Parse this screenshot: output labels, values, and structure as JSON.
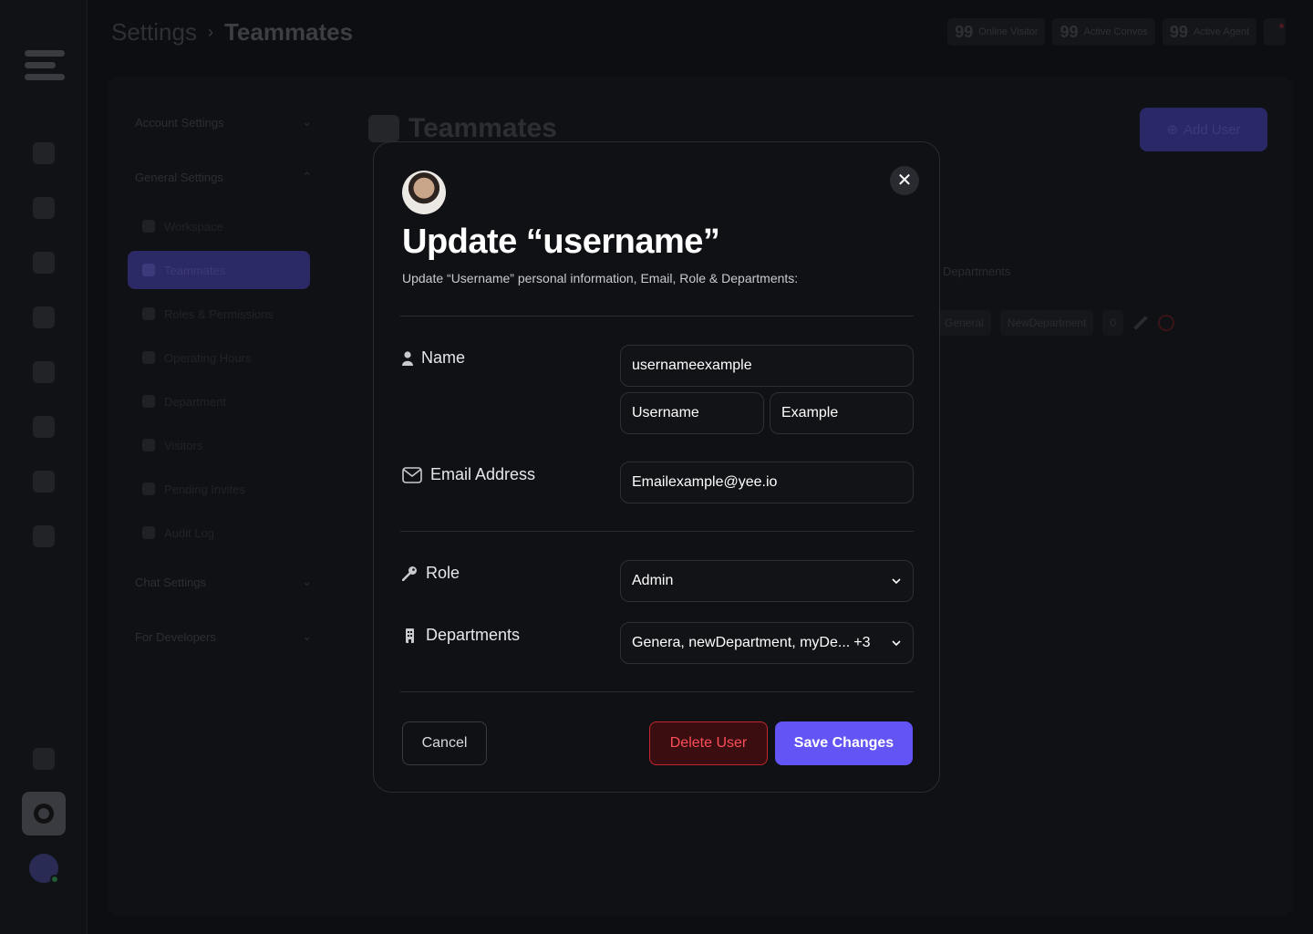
{
  "breadcrumb": {
    "parent": "Settings",
    "separator": "›",
    "current": "Teammates"
  },
  "header_stats": [
    {
      "value": "99",
      "label": "Online Visitor"
    },
    {
      "value": "99",
      "label": "Active Convos"
    },
    {
      "value": "99",
      "label": "Active Agent"
    }
  ],
  "sidebar": {
    "groups": [
      {
        "label": "Account Settings"
      },
      {
        "label": "General Settings"
      },
      {
        "label": "Chat Settings"
      },
      {
        "label": "For Developers"
      }
    ],
    "items": [
      {
        "label": "Workspace"
      },
      {
        "label": "Teammates"
      },
      {
        "label": "Roles & Permissions"
      },
      {
        "label": "Operating Hours"
      },
      {
        "label": "Department"
      },
      {
        "label": "Visitors"
      },
      {
        "label": "Pending Invites"
      },
      {
        "label": "Audit Log"
      }
    ]
  },
  "background_page": {
    "title": "Teammates",
    "add_button": "Add User",
    "table_head": "Departments",
    "row_tags": [
      "General",
      "NewDepartment",
      "0"
    ]
  },
  "modal": {
    "title": "Update “username”",
    "subtitle": "Update “Username” personal information, Email, Role & Departments:",
    "name_label": "Name",
    "username_value": "usernameexample",
    "first_name_value": "Username",
    "last_name_value": "Example",
    "email_label": "Email Address",
    "email_value": "Emailexample@yee.io",
    "role_label": "Role",
    "role_value": "Admin",
    "departments_label": "Departments",
    "departments_value": "Genera, newDepartment, myDe...",
    "departments_more": "+3",
    "cancel_label": "Cancel",
    "delete_label": "Delete User",
    "save_label": "Save Changes",
    "close_symbol": "✕"
  },
  "colors": {
    "primary": "#6354f5",
    "danger": "#ff4d57",
    "danger_border": "#c3262f",
    "modal_bg": "#101115",
    "backdrop": "#0d0e11"
  }
}
